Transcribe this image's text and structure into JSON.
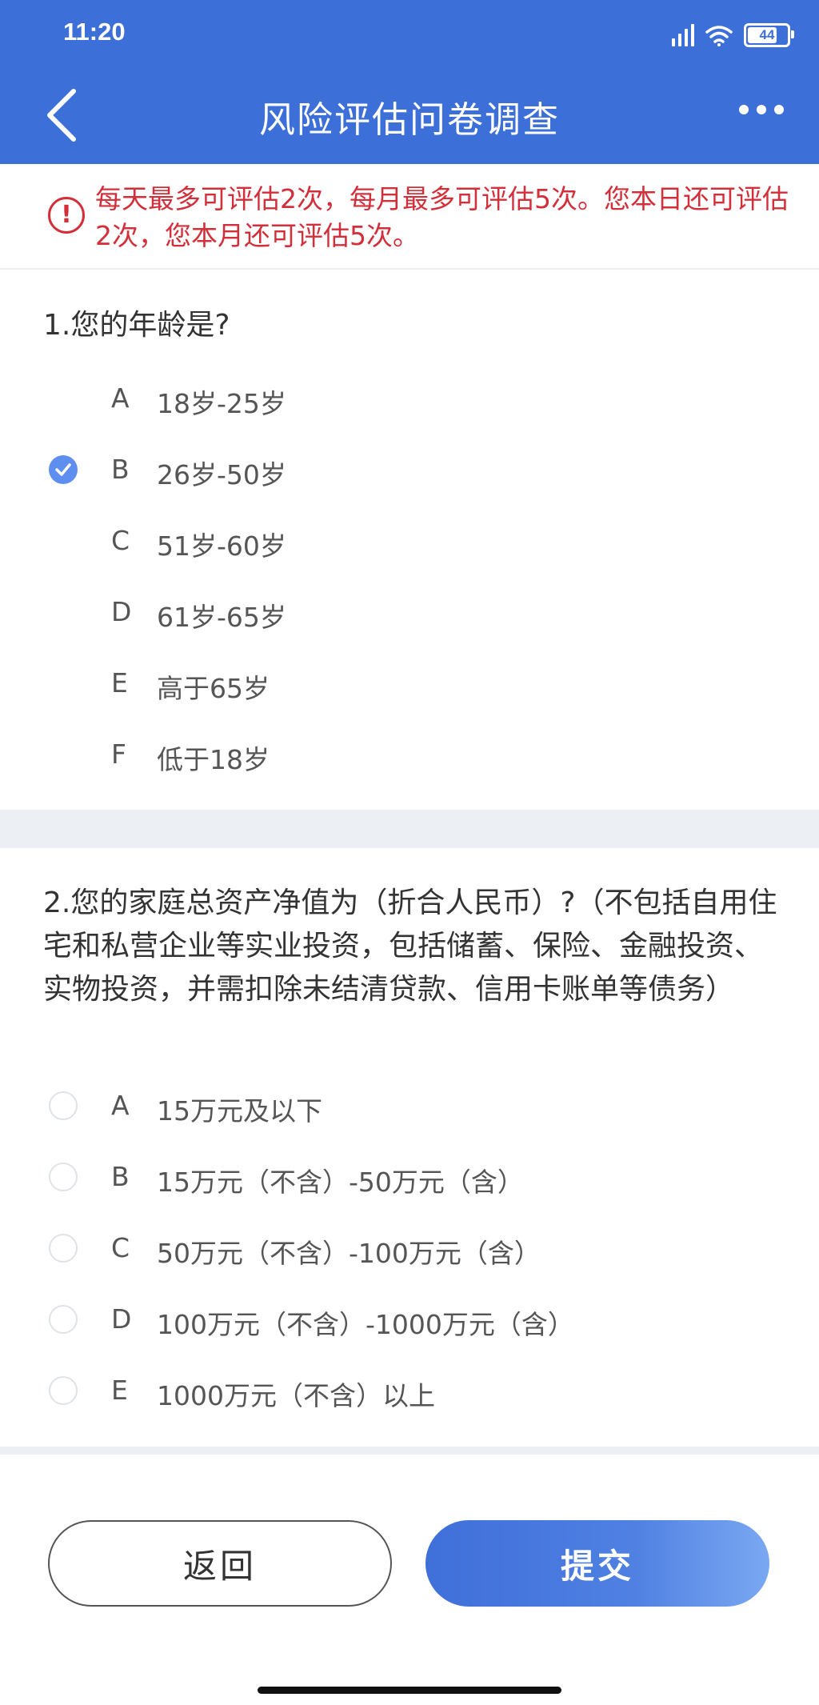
{
  "status_bar": {
    "time": "11:20",
    "battery": "44"
  },
  "header": {
    "title": "风险评估问卷调查"
  },
  "notice": {
    "text": "每天最多可评估2次，每月最多可评估5次。您本日还可评估2次，您本月还可评估5次。"
  },
  "q1": {
    "title": "1.您的年龄是?",
    "selected": "B",
    "options": [
      {
        "letter": "A",
        "text": "18岁-25岁"
      },
      {
        "letter": "B",
        "text": "26岁-50岁"
      },
      {
        "letter": "C",
        "text": "51岁-60岁"
      },
      {
        "letter": "D",
        "text": "61岁-65岁"
      },
      {
        "letter": "E",
        "text": "高于65岁"
      },
      {
        "letter": "F",
        "text": "低于18岁"
      }
    ]
  },
  "q2": {
    "title": "2.您的家庭总资产净值为（折合人民币）?（不包括自用住宅和私营企业等实业投资，包括储蓄、保险、金融投资、实物投资，并需扣除未结清贷款、信用卡账单等债务）",
    "options": [
      {
        "letter": "A",
        "text": "15万元及以下"
      },
      {
        "letter": "B",
        "text": "15万元（不含）-50万元（含）"
      },
      {
        "letter": "C",
        "text": "50万元（不含）-100万元（含）"
      },
      {
        "letter": "D",
        "text": "100万元（不含）-1000万元（含）"
      },
      {
        "letter": "E",
        "text": "1000万元（不含）以上"
      }
    ]
  },
  "footer": {
    "back_label": "返回",
    "submit_label": "提交"
  },
  "colors": {
    "header": "#3d6fd8",
    "notice": "#d32f3a",
    "radio_checked": "#5e8ff0"
  }
}
